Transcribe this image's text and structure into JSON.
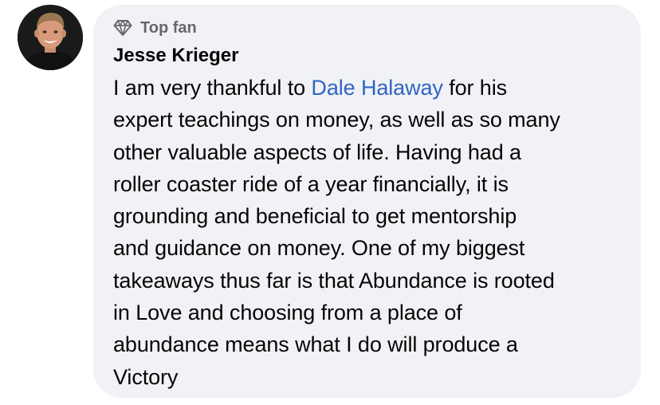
{
  "comment": {
    "avatar_icon": "profile-photo-man",
    "badge": {
      "icon": "diamond-icon",
      "label": "Top fan"
    },
    "author": "Jesse Krieger",
    "mention": "Dale Halaway",
    "mention_color": "#2f64c6",
    "lines": [
      [
        "I am very thankful to ",
        " for his"
      ],
      "expert teachings on money, as well as so many",
      "other valuable aspects of life. Having had a",
      "roller coaster ride of a year financially, it is",
      "grounding and beneficial to get mentorship",
      "and guidance on money. One of my biggest",
      "takeaways thus far is that Abundance is rooted",
      "in Love and choosing from a place of",
      "abundance means what I do will produce a",
      "Victory"
    ]
  }
}
